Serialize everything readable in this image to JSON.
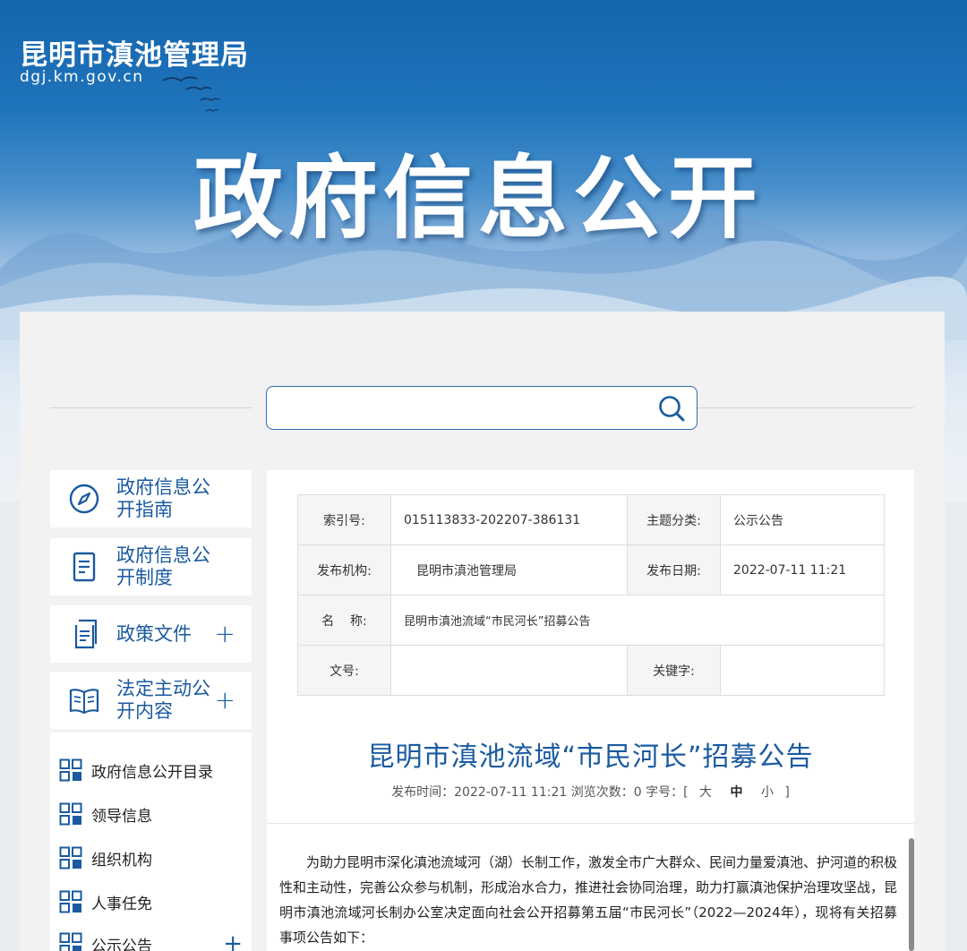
{
  "header": {
    "site_name": "昆明市滇池管理局",
    "site_domain": "dgj.km.gov.cn",
    "banner_title": "政府信息公开"
  },
  "search": {
    "placeholder": "",
    "value": "",
    "button_icon": "search-icon"
  },
  "sidebar": {
    "cards": [
      {
        "label": "政府信息公开指南",
        "icon": "compass-icon",
        "expandable": false
      },
      {
        "label": "政府信息公开制度",
        "icon": "document-icon",
        "expandable": false
      },
      {
        "label": "政策文件",
        "icon": "files-icon",
        "expandable": true
      },
      {
        "label": "法定主动公开内容",
        "icon": "book-icon",
        "expandable": true
      }
    ],
    "sub_items": [
      {
        "label": "政府信息公开目录",
        "expandable": false
      },
      {
        "label": "领导信息",
        "expandable": false
      },
      {
        "label": "组织机构",
        "expandable": false
      },
      {
        "label": "人事任免",
        "expandable": false
      },
      {
        "label": "公示公告",
        "expandable": true
      }
    ],
    "plus_symbol": "+"
  },
  "meta": {
    "index_label": "索引号:",
    "index_value": "015113833-202207-386131",
    "topic_label": "主题分类:",
    "topic_value": "公示公告",
    "publisher_label": "发布机构:",
    "publisher_value": "昆明市滇池管理局",
    "date_label": "发布日期:",
    "date_value": "2022-07-11 11:21",
    "name_label": "名    称:",
    "name_value": "昆明市滇池流域“市民河长”招募公告",
    "docno_label": "文号:",
    "docno_value": "",
    "keyword_label": "关键字:",
    "keyword_value": ""
  },
  "article": {
    "title": "昆明市滇池流域“市民河长”招募公告",
    "publish_time_label": "发布时间：",
    "publish_time": "2022-07-11 11:21",
    "views_label": "浏览次数：",
    "views": "0",
    "font_size_label": "字号：[",
    "font_large": "大",
    "font_medium": "中",
    "font_small": "小",
    "font_size_close": "]",
    "body": "为助力昆明市深化滇池流域河（湖）长制工作，激发全市广大群众、民间力量爱滇池、护河道的积极性和主动性，完善公众参与机制，形成治水合力，推进社会协同治理，助力打赢滇池保护治理攻坚战，昆明市滇池流域河长制办公室决定面向社会公开招募第五届“市民河长”（2022—2024年），现将有关招募事项公告如下："
  },
  "colors": {
    "brand_blue": "#1a5aa0",
    "banner_top": "#1565ad"
  }
}
